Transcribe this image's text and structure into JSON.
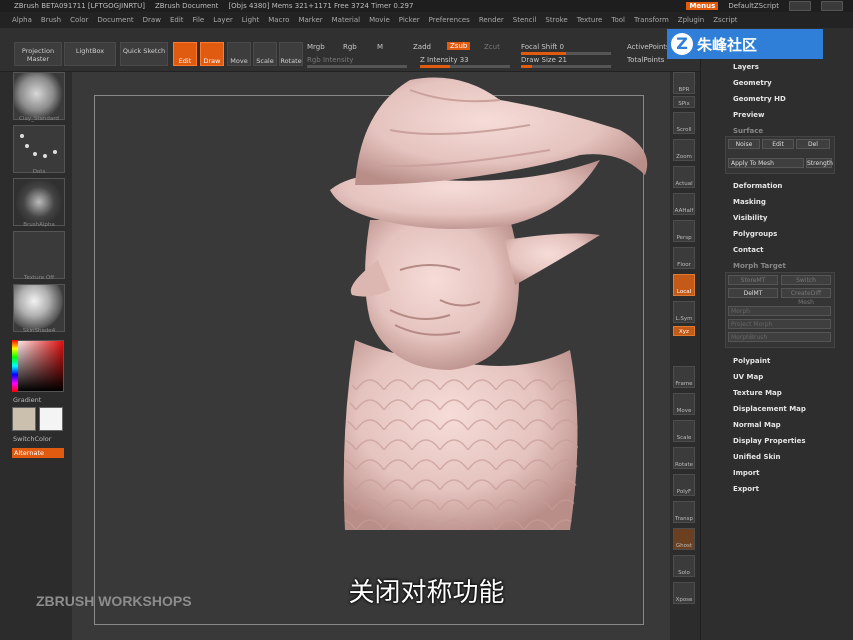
{
  "titlebar": {
    "app_title": "ZBrush BETA091711 [LFTGOGJINRTU]",
    "document": "ZBrush Document",
    "stats": "[Objs 4380]  Mems 321+1171  Free 3724  Timer 0.297",
    "menus_label": "Menus",
    "script_label": "DefaultZScript"
  },
  "menubar": [
    "Alpha",
    "Brush",
    "Color",
    "Document",
    "Draw",
    "Edit",
    "File",
    "Layer",
    "Light",
    "Macro",
    "Marker",
    "Material",
    "Movie",
    "Picker",
    "Preferences",
    "Render",
    "Stencil",
    "Stroke",
    "Texture",
    "Tool",
    "Transform",
    "Zplugin",
    "Zscript"
  ],
  "toolbar": {
    "projection_master": "Projection Master",
    "lightbox": "LightBox",
    "quick_sketch": "Quick Sketch",
    "edit": "Edit",
    "draw": "Draw",
    "move": "Move",
    "scale": "Scale",
    "rotate": "Rotate",
    "mrgb": "Mrgb",
    "rgb": "Rgb",
    "m": "M",
    "rgb_intensity": "Rgb Intensity",
    "zadd": "Zadd",
    "zsub": "Zsub",
    "zcut": "Zcut",
    "z_intensity": "Z Intensity 33",
    "focal_shift": "Focal Shift 0",
    "draw_size": "Draw Size 21",
    "active_points": "ActivePoints",
    "total_points": "TotalPoints"
  },
  "left_shelf": {
    "brush": "Clay_Standard",
    "stroke": "Dots",
    "alpha": "BrushAlpha",
    "texture": "Texture Off",
    "material": "SkinShade4",
    "gradient": "Gradient",
    "switch_color": "SwitchColor",
    "alternate": "Alternate"
  },
  "right_shelf": [
    "BPR",
    "SPix",
    "Scroll",
    "Zoom",
    "Actual",
    "AAHalf",
    "Persp",
    "Floor",
    "Local",
    "L.Sym",
    "Xyz",
    "Frame",
    "Move",
    "Scale",
    "Rotate",
    "PolyF",
    "Transp",
    "Ghost",
    "Solo",
    "Xpose"
  ],
  "palette": {
    "layers": "Layers",
    "geometry": "Geometry",
    "geometry_hd": "Geometry HD",
    "preview": "Preview",
    "surface": "Surface",
    "noise": "Noise",
    "edit": "Edit",
    "del": "Del",
    "apply_to_mesh": "Apply To Mesh",
    "strength": "Strength",
    "deformation": "Deformation",
    "masking": "Masking",
    "visibility": "Visibility",
    "polygroups": "Polygroups",
    "contact": "Contact",
    "morph_target": "Morph Target",
    "store_mt": "StoreMT",
    "switch": "Switch",
    "del_mt": "DelMT",
    "create_diff_mesh": "CreateDiff Mesh",
    "morph": "Morph",
    "project_morph": "Project Morph",
    "morph_brush": "MorphBrush",
    "polypaint": "Polypaint",
    "uv_map": "UV Map",
    "texture_map": "Texture Map",
    "displacement_map": "Displacement Map",
    "normal_map": "Normal Map",
    "display_properties": "Display Properties",
    "unified_skin": "Unified Skin",
    "import": "Import",
    "export": "Export"
  },
  "logo": {
    "text": "朱峰社区",
    "mark": "Z"
  },
  "subtitle": "关闭对称功能",
  "watermark": "ZBRUSH WORKSHOPS",
  "colors": {
    "accent": "#e05a10",
    "logo_blue": "#2f7fd8",
    "model_skin": "#e8c7c2"
  }
}
